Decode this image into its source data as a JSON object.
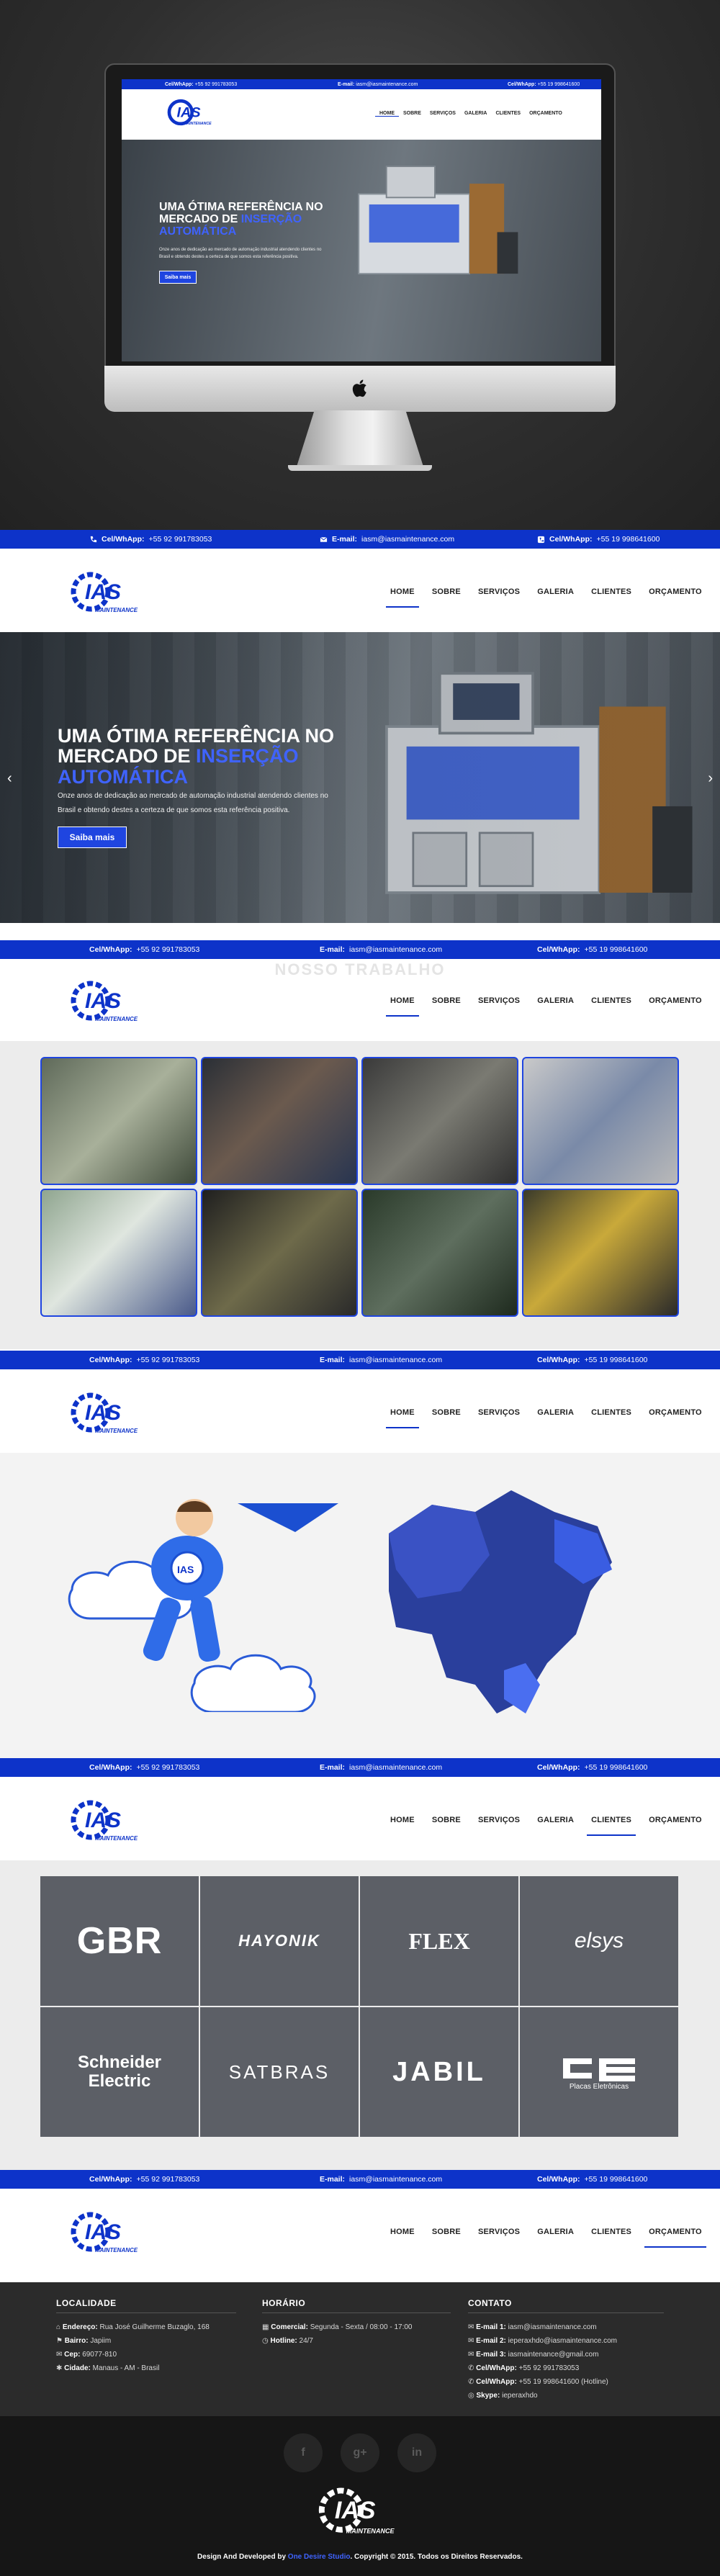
{
  "topbar": {
    "phone_label": "Cel/WhApp:",
    "phone_value": "+55 92 991783053",
    "email_label": "E-mail:",
    "email_value": "iasm@iasmaintenance.com",
    "whatsapp_label": "Cel/WhApp:",
    "whatsapp_value": "+55 19 998641600"
  },
  "logo": {
    "brand": "IAS",
    "sub": "MAINTENANCE"
  },
  "nav": [
    "HOME",
    "SOBRE",
    "SERVIÇOS",
    "GALERIA",
    "CLIENTES",
    "ORÇAMENTO"
  ],
  "hero": {
    "title_line1": "UMA ÓTIMA REFERÊNCIA NO",
    "title_line2_pre": "MERCADO DE ",
    "title_line2_hl": "INSERÇÃO",
    "title_line3_hl": "AUTOMÁTICA",
    "text_line1": "Onze anos de dedicação ao mercado de automação industrial atendendo clientes no",
    "text_line2": "Brasil e obtendo destes a certeza de que somos esta referência positiva.",
    "button": "Saiba mais"
  },
  "gallery_ghost_title": "NOSSO TRABALHO",
  "clients": [
    "GBR",
    "HAYONIK",
    "FLEX",
    "elsys",
    "Schneider Electric",
    "SATBRAS",
    "JABIL",
    "Placas Eletrônicas"
  ],
  "footer": {
    "local_title": "LOCALIDADE",
    "address_label": "Endereço:",
    "address_value": "Rua José Guilherme Buzaglo, 168",
    "bairro_label": "Bairro:",
    "bairro_value": "Japiim",
    "cep_label": "Cep:",
    "cep_value": "69077-810",
    "cidade_label": "Cidade:",
    "cidade_value": "Manaus - AM - Brasil",
    "hours_title": "HORÁRIO",
    "commercial_label": "Comercial:",
    "commercial_value": "Segunda - Sexta / 08:00 - 17:00",
    "hotline_label": "Hotline:",
    "hotline_value": "24/7",
    "contact_title": "CONTATO",
    "email1_label": "E-mail 1:",
    "email1_value": "iasm@iasmaintenance.com",
    "email2_label": "E-mail 2:",
    "email2_value": "ieperaxhdo@iasmaintenance.com",
    "email3_label": "E-mail 3:",
    "email3_value": "iasmaintenance@gmail.com",
    "cel1_label": "Cel/WhApp:",
    "cel1_value": "+55 92 991783053",
    "cel2_label": "Cel/WhApp:",
    "cel2_value": "+55 19 998641600 (Hotline)",
    "skype_label": "Skype:",
    "skype_value": "ieperaxhdo"
  },
  "social": [
    "f",
    "g+",
    "in"
  ],
  "credit": {
    "pre": "Design And Developed by",
    "studio": "One Desire Studio",
    "post": ". Copyright © 2015. Todos os Direitos Reservados."
  },
  "colors": {
    "primary": "#0d33c9",
    "highlight": "#3f63ff",
    "client_tile": "#5c5f66",
    "footer": "#2b2b2b"
  }
}
